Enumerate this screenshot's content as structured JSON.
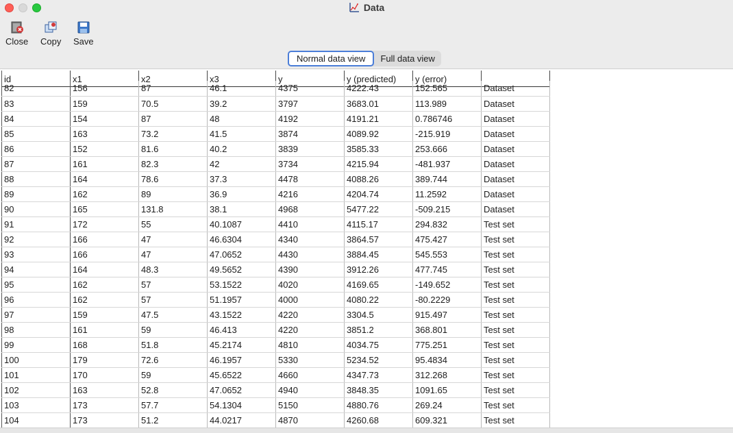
{
  "window": {
    "title": "Data",
    "icon": "chart-icon"
  },
  "toolbar": {
    "close_label": "Close",
    "copy_label": "Copy",
    "save_label": "Save"
  },
  "view_toggle": {
    "normal_label": "Normal data view",
    "full_label": "Full data view",
    "selected": "Normal data view"
  },
  "table": {
    "columns": [
      "id",
      "x1",
      "x2",
      "x3",
      "y",
      "y (predicted)",
      "y (error)",
      ""
    ],
    "rows": [
      [
        "82",
        "156",
        "87",
        "46.1",
        "4375",
        "4222.43",
        "152.565",
        "Dataset"
      ],
      [
        "83",
        "159",
        "70.5",
        "39.2",
        "3797",
        "3683.01",
        "113.989",
        "Dataset"
      ],
      [
        "84",
        "154",
        "87",
        "48",
        "4192",
        "4191.21",
        "0.786746",
        "Dataset"
      ],
      [
        "85",
        "163",
        "73.2",
        "41.5",
        "3874",
        "4089.92",
        "-215.919",
        "Dataset"
      ],
      [
        "86",
        "152",
        "81.6",
        "40.2",
        "3839",
        "3585.33",
        "253.666",
        "Dataset"
      ],
      [
        "87",
        "161",
        "82.3",
        "42",
        "3734",
        "4215.94",
        "-481.937",
        "Dataset"
      ],
      [
        "88",
        "164",
        "78.6",
        "37.3",
        "4478",
        "4088.26",
        "389.744",
        "Dataset"
      ],
      [
        "89",
        "162",
        "89",
        "36.9",
        "4216",
        "4204.74",
        "11.2592",
        "Dataset"
      ],
      [
        "90",
        "165",
        "131.8",
        "38.1",
        "4968",
        "5477.22",
        "-509.215",
        "Dataset"
      ],
      [
        "91",
        "172",
        "55",
        "40.1087",
        "4410",
        "4115.17",
        "294.832",
        "Test set"
      ],
      [
        "92",
        "166",
        "47",
        "46.6304",
        "4340",
        "3864.57",
        "475.427",
        "Test set"
      ],
      [
        "93",
        "166",
        "47",
        "47.0652",
        "4430",
        "3884.45",
        "545.553",
        "Test set"
      ],
      [
        "94",
        "164",
        "48.3",
        "49.5652",
        "4390",
        "3912.26",
        "477.745",
        "Test set"
      ],
      [
        "95",
        "162",
        "57",
        "53.1522",
        "4020",
        "4169.65",
        "-149.652",
        "Test set"
      ],
      [
        "96",
        "162",
        "57",
        "51.1957",
        "4000",
        "4080.22",
        "-80.2229",
        "Test set"
      ],
      [
        "97",
        "159",
        "47.5",
        "43.1522",
        "4220",
        "3304.5",
        "915.497",
        "Test set"
      ],
      [
        "98",
        "161",
        "59",
        "46.413",
        "4220",
        "3851.2",
        "368.801",
        "Test set"
      ],
      [
        "99",
        "168",
        "51.8",
        "45.2174",
        "4810",
        "4034.75",
        "775.251",
        "Test set"
      ],
      [
        "100",
        "179",
        "72.6",
        "46.1957",
        "5330",
        "5234.52",
        "95.4834",
        "Test set"
      ],
      [
        "101",
        "170",
        "59",
        "45.6522",
        "4660",
        "4347.73",
        "312.268",
        "Test set"
      ],
      [
        "102",
        "163",
        "52.8",
        "47.0652",
        "4940",
        "3848.35",
        "1091.65",
        "Test set"
      ],
      [
        "103",
        "173",
        "57.7",
        "54.1304",
        "5150",
        "4880.76",
        "269.24",
        "Test set"
      ],
      [
        "104",
        "173",
        "51.2",
        "44.0217",
        "4870",
        "4260.68",
        "609.321",
        "Test set"
      ]
    ]
  }
}
